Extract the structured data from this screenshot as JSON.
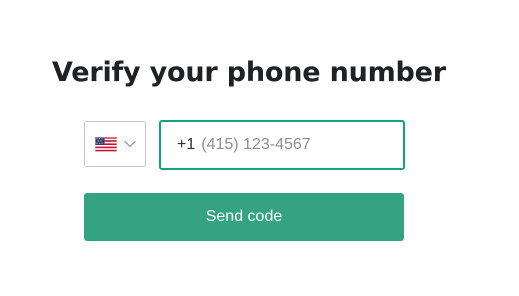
{
  "page": {
    "title": "Verify your phone number"
  },
  "country_select": {
    "selected_country": "United States",
    "flag_icon": "us-flag-icon",
    "chevron_icon": "chevron-down-icon"
  },
  "phone_input": {
    "dial_code": "+1",
    "value": "",
    "placeholder": "(415) 123-4567"
  },
  "send_button": {
    "label": "Send code"
  },
  "colors": {
    "accent": "#10a37f",
    "button": "#34a37f",
    "button_text": "#ffffff",
    "title_text": "#202123",
    "placeholder_text": "#8e8ea0",
    "select_border": "#c2c8d0"
  }
}
